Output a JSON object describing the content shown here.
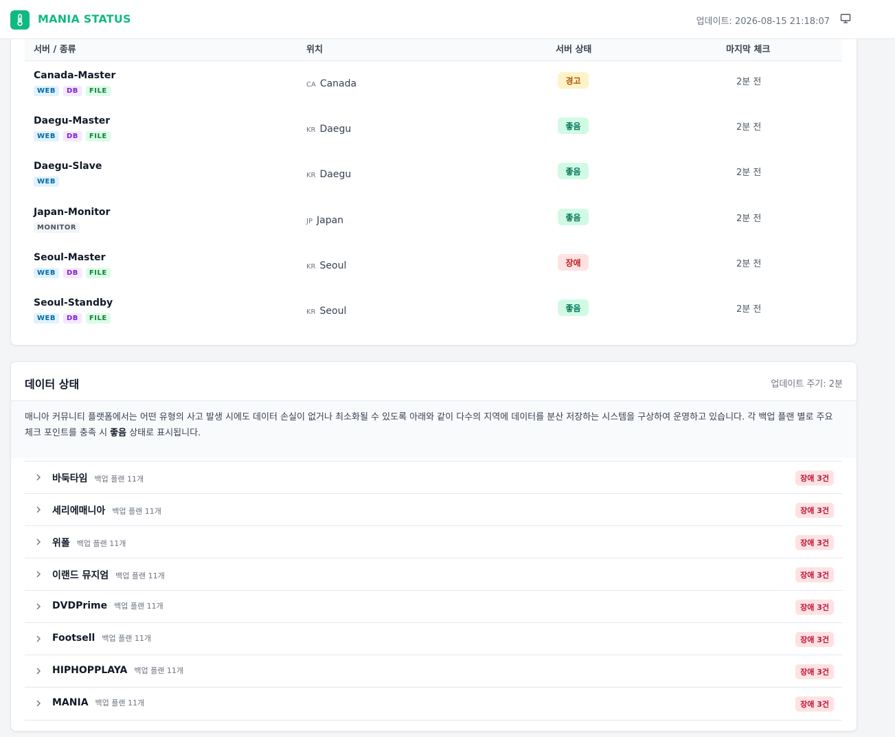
{
  "header": {
    "brand": "MANIA STATUS",
    "update_label": "업데이트: 2026-08-15 21:18:07",
    "logo_icon": "thermometer-icon",
    "display_icon": "monitor-icon",
    "accent": "#10b981"
  },
  "servers": {
    "columns": [
      "서버 / 종류",
      "위치",
      "서버 상태",
      "마지막 체크"
    ],
    "rows": [
      {
        "name": "Canada-Master",
        "tags": [
          "WEB",
          "DB",
          "FILE"
        ],
        "country_code": "CA",
        "location": "Canada",
        "status": "경고",
        "status_kind": "warn",
        "last_check": "2분 전"
      },
      {
        "name": "Daegu-Master",
        "tags": [
          "WEB",
          "DB",
          "FILE"
        ],
        "country_code": "KR",
        "location": "Daegu",
        "status": "좋음",
        "status_kind": "good",
        "last_check": "2분 전"
      },
      {
        "name": "Daegu-Slave",
        "tags": [
          "WEB"
        ],
        "country_code": "KR",
        "location": "Daegu",
        "status": "좋음",
        "status_kind": "good",
        "last_check": "2분 전"
      },
      {
        "name": "Japan-Monitor",
        "tags": [
          "MONITOR"
        ],
        "country_code": "JP",
        "location": "Japan",
        "status": "좋음",
        "status_kind": "good",
        "last_check": "2분 전"
      },
      {
        "name": "Seoul-Master",
        "tags": [
          "WEB",
          "DB",
          "FILE"
        ],
        "country_code": "KR",
        "location": "Seoul",
        "status": "장애",
        "status_kind": "bad",
        "last_check": "2분 전"
      },
      {
        "name": "Seoul-Standby",
        "tags": [
          "WEB",
          "DB",
          "FILE"
        ],
        "country_code": "KR",
        "location": "Seoul",
        "status": "좋음",
        "status_kind": "good",
        "last_check": "2분 전"
      }
    ]
  },
  "data_status": {
    "title": "데이터 상태",
    "cycle": "업데이트 주기: 2분",
    "desc_before": "매니아 커뮤니티 플랫폼에서는 어떤 유형의 사고 발생 시에도 데이터 손실이 없거나 최소화될 수 있도록 아래와 같이 다수의 지역에 데이터를 분산 저장하는 시스템을 구상하여 운영하고 있습니다. 각 백업 플랜 별로 주요 체크 포인트를 충족 시 ",
    "desc_bold": "좋음",
    "desc_after": " 상태로 표시됩니다.",
    "items": [
      {
        "name": "바둑타임",
        "plan": "백업 플랜 11개",
        "badge": "장애 3건"
      },
      {
        "name": "세리에매니아",
        "plan": "백업 플랜 11개",
        "badge": "장애 3건"
      },
      {
        "name": "위폴",
        "plan": "백업 플랜 11개",
        "badge": "장애 3건"
      },
      {
        "name": "이랜드 뮤지엄",
        "plan": "백업 플랜 11개",
        "badge": "장애 3건"
      },
      {
        "name": "DVDPrime",
        "plan": "백업 플랜 11개",
        "badge": "장애 3건"
      },
      {
        "name": "Footsell",
        "plan": "백업 플랜 11개",
        "badge": "장애 3건"
      },
      {
        "name": "HIPHOPPLAYA",
        "plan": "백업 플랜 11개",
        "badge": "장애 3건"
      },
      {
        "name": "MANIA",
        "plan": "백업 플랜 11개",
        "badge": "장애 3건"
      }
    ]
  }
}
